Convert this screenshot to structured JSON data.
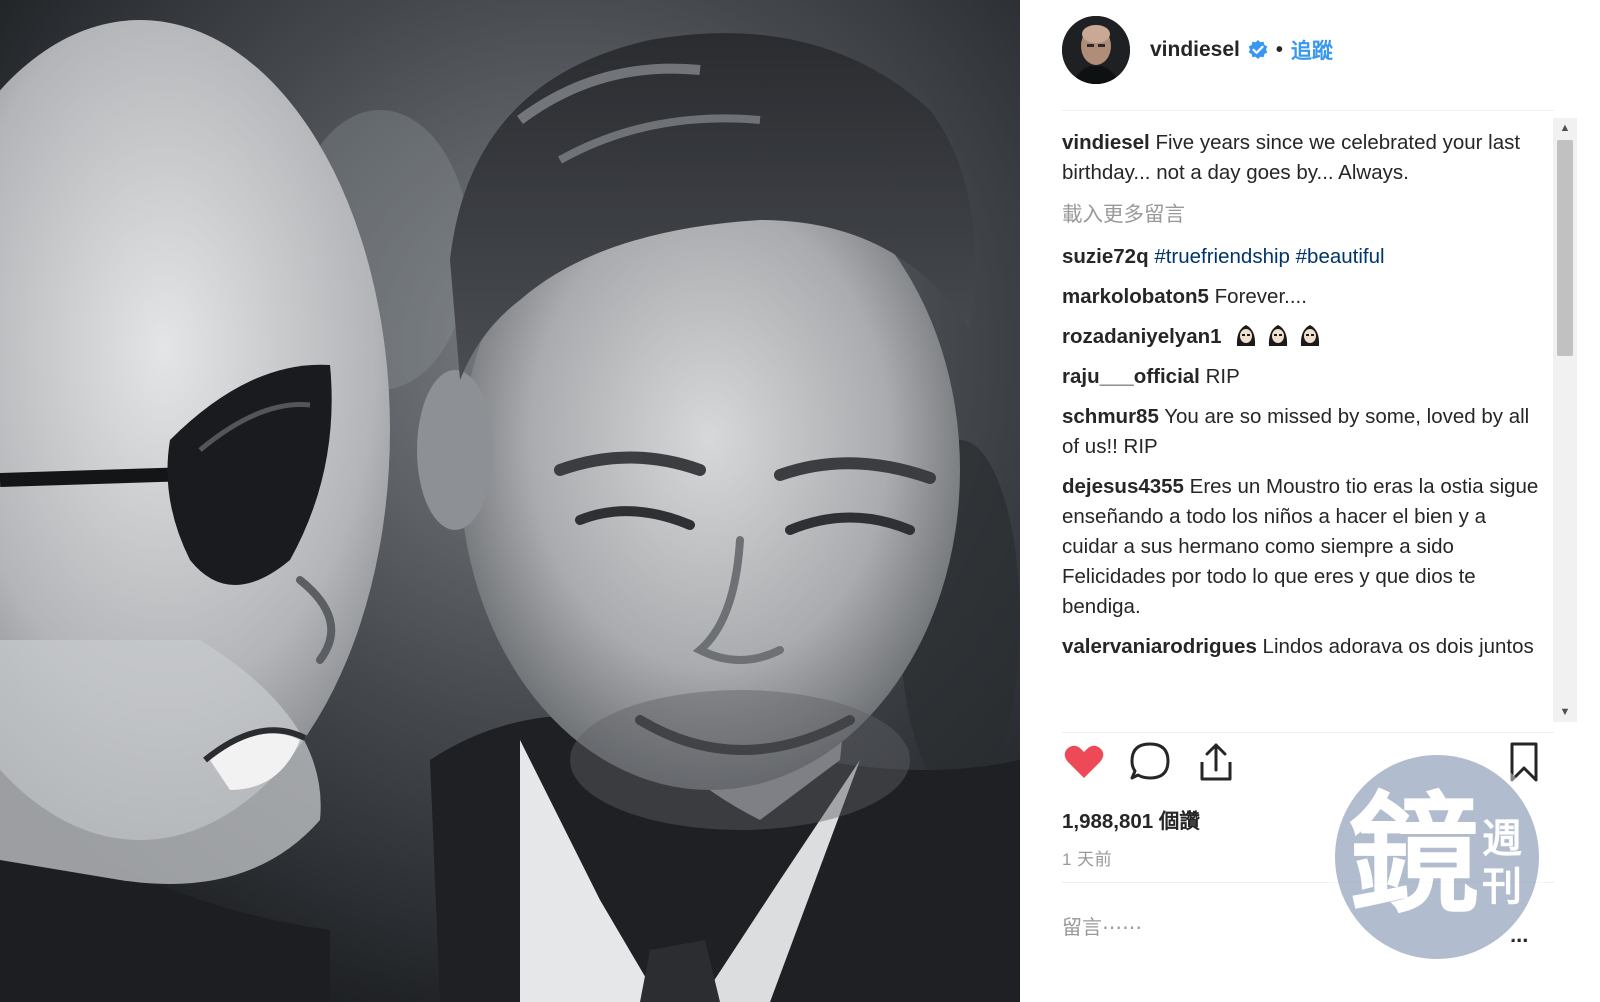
{
  "post": {
    "username": "vindiesel",
    "verified_icon": "verified-badge-icon",
    "separator": "•",
    "follow_label": "追蹤"
  },
  "comments": {
    "caption": {
      "user": "vindiesel",
      "text": "Five years since we celebrated your last birthday... not a day goes by... Always."
    },
    "load_more": "載入更多留言",
    "items": [
      {
        "user": "suzie72q",
        "text": "",
        "hashtags": [
          "#truefriendship",
          "#beautiful"
        ]
      },
      {
        "user": "markolobaton5",
        "text": "Forever...."
      },
      {
        "user": "rozadaniyelyan1",
        "text": "",
        "emoji": "ghost-emoji-icon"
      },
      {
        "user": "raju___official",
        "text": "RIP"
      },
      {
        "user": "schmur85",
        "text": "You are so missed by some, loved by all of us!! RIP"
      },
      {
        "user": "dejesus4355",
        "text": "Eres un Moustro tio eras la ostia sigue enseñando a todo los niños a hacer el bien y a cuidar a sus hermano como siempre a sido Felicidades por todo lo que eres y que dios te bendiga."
      },
      {
        "user": "valervaniarodrigues",
        "text": "Lindos adorava os dois juntos"
      }
    ]
  },
  "actions": {
    "like_icon": "heart-icon",
    "comment_icon": "comment-bubble-icon",
    "share_icon": "share-icon",
    "save_icon": "bookmark-icon",
    "like_color": "#ed4956"
  },
  "stats": {
    "views": "1,988,801 個讚",
    "time_ago": "1 天前"
  },
  "comment_box": {
    "placeholder": "留言⋯⋯"
  },
  "more_options": "...",
  "watermark": {
    "brand_main": "鏡",
    "brand_side_top": "週",
    "brand_side_bottom": "刊"
  },
  "colors": {
    "accent": "#3897f0",
    "hashtag": "#003569",
    "muted": "#999999",
    "text": "#262626"
  }
}
